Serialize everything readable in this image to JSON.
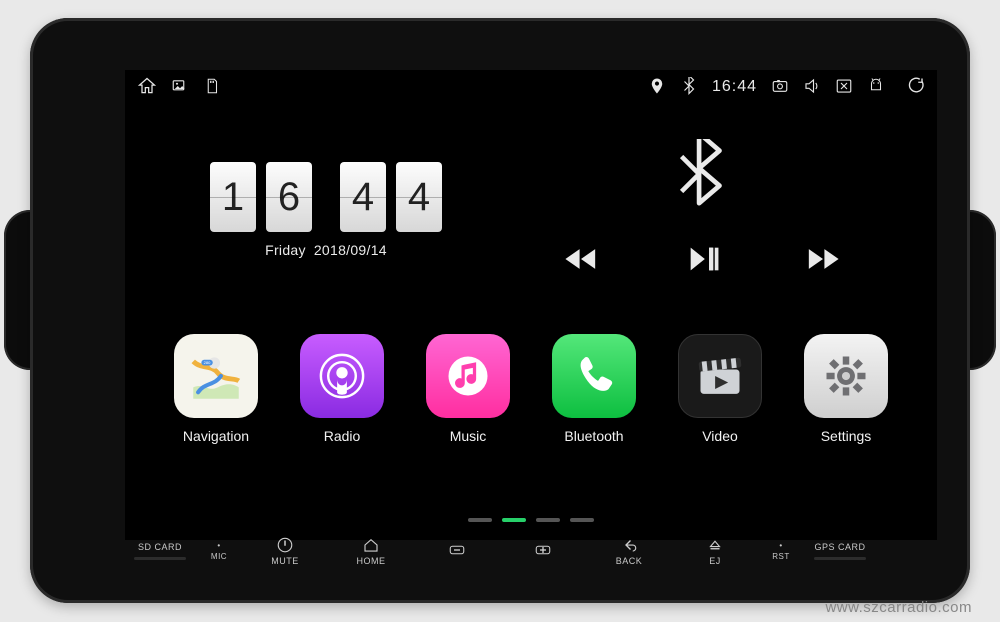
{
  "status": {
    "time": "16:44"
  },
  "clock": {
    "h1": "1",
    "h2": "6",
    "m1": "4",
    "m2": "4",
    "weekday": "Friday",
    "date": "2018/09/14"
  },
  "apps": [
    {
      "key": "navigation",
      "label": "Navigation",
      "bg": "#f6f6f0"
    },
    {
      "key": "radio",
      "label": "Radio",
      "bg": "linear-gradient(#d76dff,#8a2be2)"
    },
    {
      "key": "music",
      "label": "Music",
      "bg": "linear-gradient(#ff6bd6,#ff3fa4)"
    },
    {
      "key": "bluetooth",
      "label": "Bluetooth",
      "bg": "linear-gradient(#4ee26f,#0bbb3e)"
    },
    {
      "key": "video",
      "label": "Video",
      "bg": "#1a1a1a"
    },
    {
      "key": "settings",
      "label": "Settings",
      "bg": "linear-gradient(#f3f3f3,#cfcfcf)"
    }
  ],
  "hw": {
    "sd": "SD CARD",
    "mic": "MIC",
    "mute": "MUTE",
    "home": "HOME",
    "voldn": "",
    "volup": "",
    "back": "BACK",
    "ej": "EJ",
    "rst": "RST",
    "gps": "GPS CARD"
  },
  "watermark": "www.szcarradio.com"
}
